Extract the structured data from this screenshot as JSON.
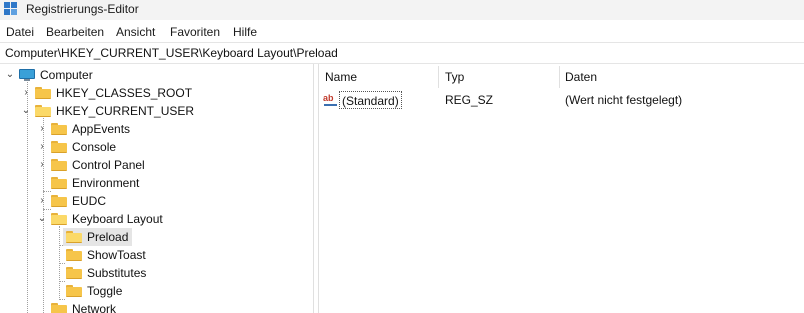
{
  "window": {
    "title": "Registrierungs-Editor"
  },
  "menu": {
    "items": [
      "Datei",
      "Bearbeiten",
      "Ansicht",
      "Favoriten",
      "Hilfe"
    ]
  },
  "address": {
    "path": "Computer\\HKEY_CURRENT_USER\\Keyboard Layout\\Preload"
  },
  "tree": {
    "computer": "Computer",
    "hkcr": "HKEY_CLASSES_ROOT",
    "hkcu": "HKEY_CURRENT_USER",
    "appevents": "AppEvents",
    "console": "Console",
    "control_panel": "Control Panel",
    "environment": "Environment",
    "eudc": "EUDC",
    "keyboard_layout": "Keyboard Layout",
    "preload": "Preload",
    "showtoast": "ShowToast",
    "substitutes": "Substitutes",
    "toggle": "Toggle",
    "network": "Network"
  },
  "list": {
    "headers": {
      "name": "Name",
      "type": "Typ",
      "data": "Daten"
    },
    "rows": [
      {
        "name": "(Standard)",
        "type": "REG_SZ",
        "data": "(Wert nicht festgelegt)",
        "icon": "string-value-icon"
      }
    ]
  },
  "colors": {
    "folder": "#f6c54a",
    "selection": "#e5e5e5",
    "accent": "#2f78c8"
  }
}
